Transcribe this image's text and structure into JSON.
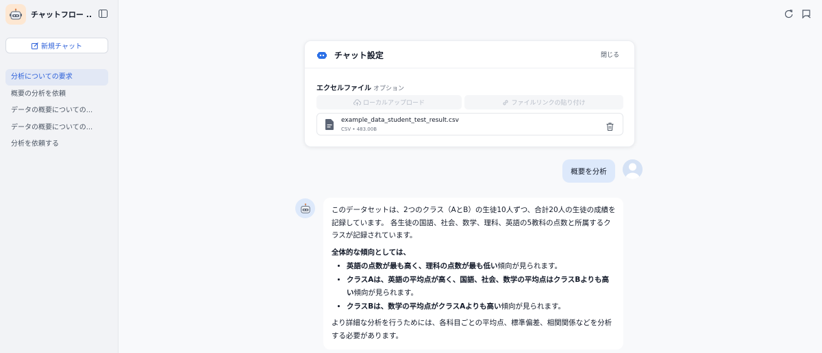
{
  "app": {
    "title": "チャットフロー ..."
  },
  "sidebar": {
    "new_chat_label": "新規チャット",
    "items": [
      {
        "label": "分析についての要求",
        "active": true
      },
      {
        "label": "概要の分析を依頼",
        "active": false
      },
      {
        "label": "データの概要についての...",
        "active": false
      },
      {
        "label": "データの概要についての...",
        "active": false
      },
      {
        "label": "分析を依頼する",
        "active": false
      }
    ]
  },
  "settings": {
    "title": "チャット設定",
    "close_label": "閉じる",
    "excel_label": "エクセルファイル",
    "option_label": "オプション",
    "local_upload_label": "ローカルアップロード",
    "file_link_label": "ファイルリンクの貼り付け",
    "file": {
      "name": "example_data_student_test_result.csv",
      "type": "CSV",
      "size": "483.00B"
    }
  },
  "messages": {
    "user_text": "概要を分析",
    "bot": {
      "intro": "このデータセットは、2つのクラス（AとB）の生徒10人ずつ、合計20人の生徒の成績を記録しています。 各生徒の国語、社会、数学、理科、英語の5教科の点数と所属するクラスが記録されています。",
      "heading": "全体的な傾向としては、",
      "bullets": [
        {
          "bold": "英語の点数が最も高く、理科の点数が最も低い",
          "rest": "傾向が見られます。"
        },
        {
          "bold": "クラスAは、英語の平均点が高く、国語、社会、数学の平均点はクラスBよりも高い",
          "rest": "傾向が見られます。"
        },
        {
          "bold": "クラスBは、数学の平均点がクラスAよりも高い",
          "rest": "傾向が見られます。"
        }
      ],
      "outro": "より詳細な分析を行うためには、各科目ごとの平均点、標準偏差、相関関係などを分析する必要があります。"
    }
  },
  "colors": {
    "accent": "#2b5fd9",
    "active_nav_bg": "#e2e8f5",
    "user_bubble": "#dde9fb"
  },
  "icons": {
    "app_logo": "robot-icon",
    "collapse": "sidebar-toggle-icon",
    "new_chat": "edit-icon",
    "refresh": "refresh-icon",
    "flag": "flag-icon",
    "settings": "bot-icon",
    "upload": "cloud-upload-icon",
    "link": "link-icon",
    "file": "document-icon",
    "delete": "trash-icon"
  }
}
